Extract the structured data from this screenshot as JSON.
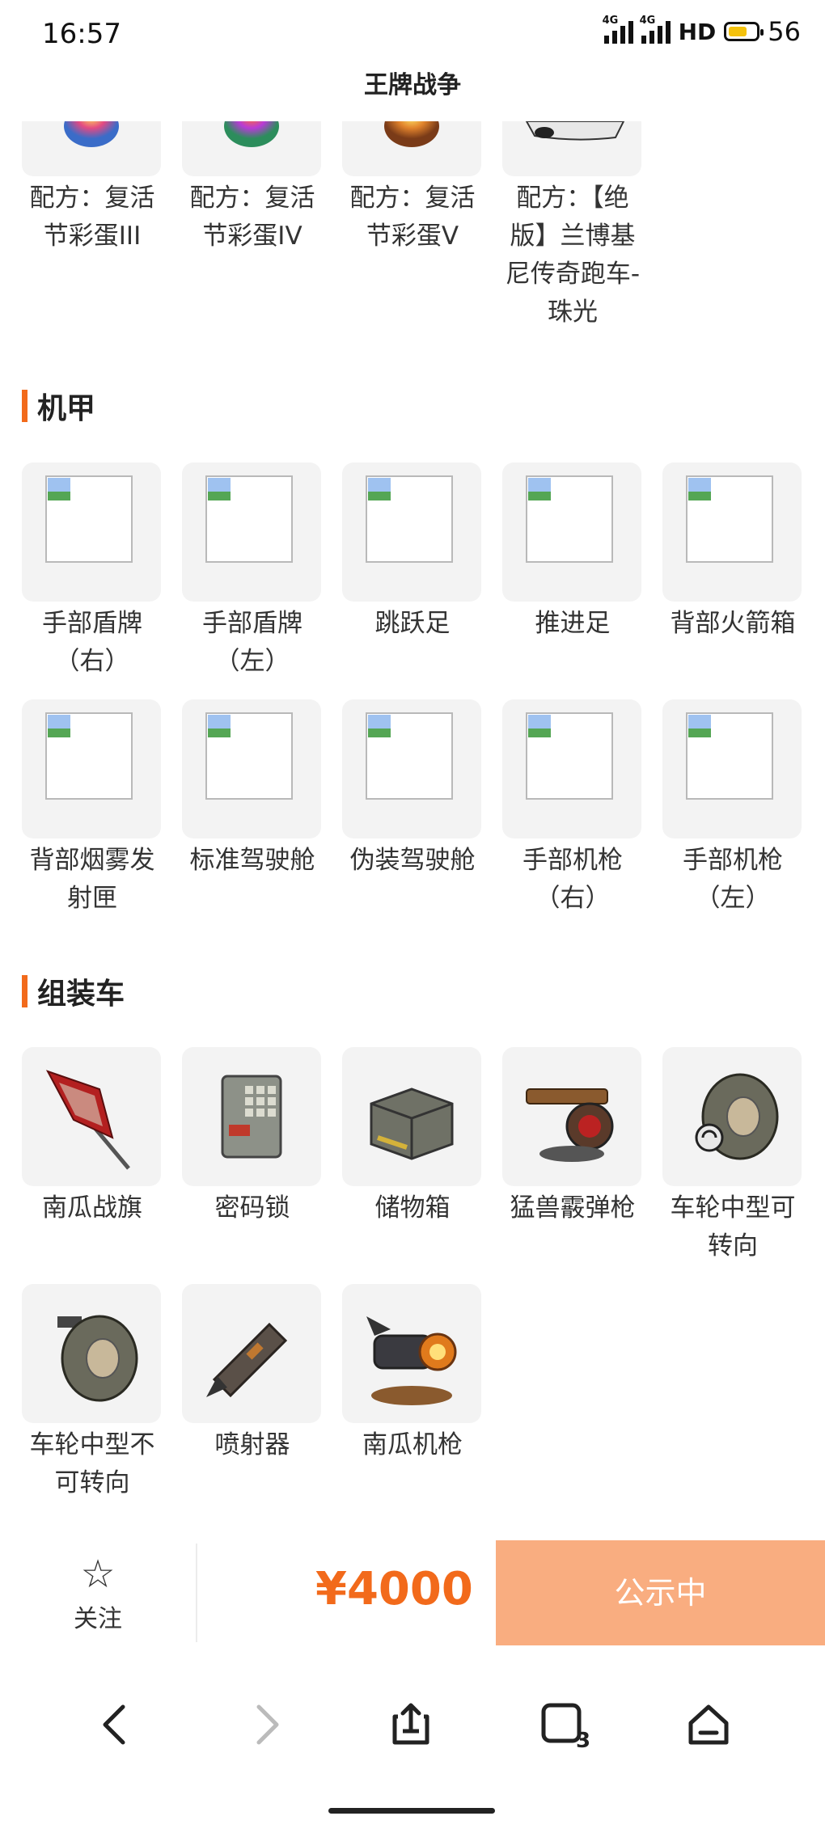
{
  "status_bar": {
    "time": "16:57",
    "network1": "4G",
    "network2": "4G",
    "hd": "HD",
    "battery": "56",
    "battery_level": 0.58,
    "battery_color": "#f4c20d"
  },
  "page_title": "王牌战争",
  "sections": [
    {
      "title": "",
      "items": [
        {
          "label": "配方：复活节彩蛋III",
          "icon": "easter-egg-icon"
        },
        {
          "label": "配方：复活节彩蛋IV",
          "icon": "easter-egg-icon"
        },
        {
          "label": "配方：复活节彩蛋V",
          "icon": "easter-egg-icon"
        },
        {
          "label": "配方：【绝版】兰博基尼传奇跑车-珠光",
          "icon": "sports-car-icon"
        }
      ]
    },
    {
      "title": "机甲",
      "items": [
        {
          "label": "手部盾牌（右）",
          "icon": "broken-image-icon"
        },
        {
          "label": "手部盾牌（左）",
          "icon": "broken-image-icon"
        },
        {
          "label": "跳跃足",
          "icon": "broken-image-icon"
        },
        {
          "label": "推进足",
          "icon": "broken-image-icon"
        },
        {
          "label": "背部火箭箱",
          "icon": "broken-image-icon"
        },
        {
          "label": "背部烟雾发射匣",
          "icon": "broken-image-icon"
        },
        {
          "label": "标准驾驶舱",
          "icon": "broken-image-icon"
        },
        {
          "label": "伪装驾驶舱",
          "icon": "broken-image-icon"
        },
        {
          "label": "手部机枪（右）",
          "icon": "broken-image-icon"
        },
        {
          "label": "手部机枪（左）",
          "icon": "broken-image-icon"
        }
      ]
    },
    {
      "title": "组装车",
      "items": [
        {
          "label": "南瓜战旗",
          "icon": "pumpkin-flag-icon"
        },
        {
          "label": "密码锁",
          "icon": "code-lock-icon"
        },
        {
          "label": "储物箱",
          "icon": "storage-box-icon"
        },
        {
          "label": "猛兽霰弹枪",
          "icon": "beast-shotgun-icon"
        },
        {
          "label": "车轮中型可转向",
          "icon": "wheel-steerable-icon"
        },
        {
          "label": "车轮中型不可转向",
          "icon": "wheel-fixed-icon"
        },
        {
          "label": "喷射器",
          "icon": "thruster-icon"
        },
        {
          "label": "南瓜机枪",
          "icon": "pumpkin-machine-gun-icon"
        }
      ]
    }
  ],
  "bottom_bar": {
    "follow_label": "关注",
    "price": "¥4000",
    "status_button": "公示中",
    "accent_color": "#f26a1b",
    "button_color": "#f9ad80"
  },
  "browser_nav": {
    "back": "back-arrow-icon",
    "forward": "forward-arrow-icon",
    "share": "share-icon",
    "tabs_count": "3",
    "home": "home-icon"
  }
}
